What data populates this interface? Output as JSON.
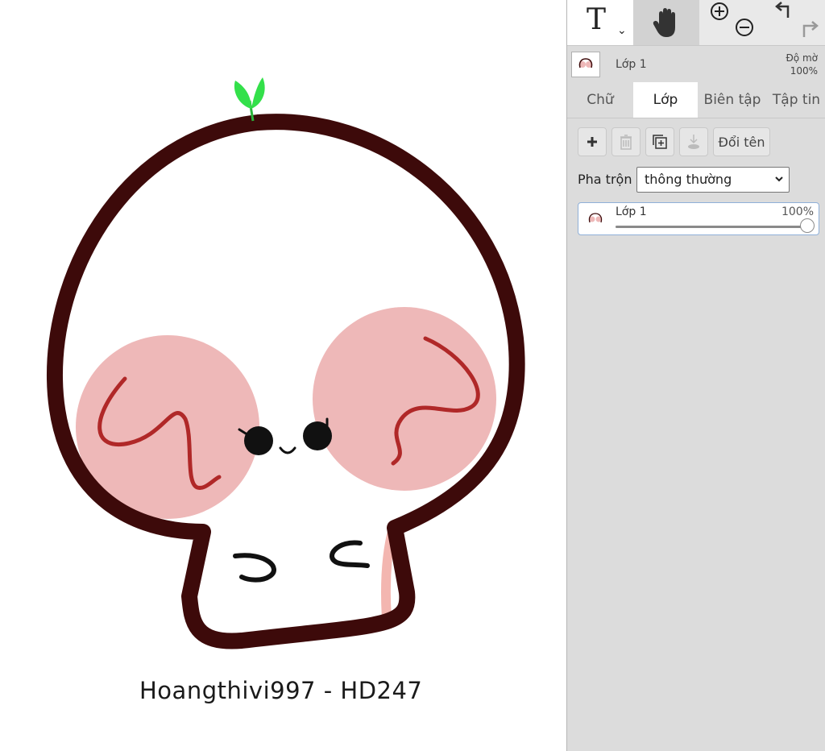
{
  "toolbar": {
    "text_tool_glyph": "T",
    "text_tool_caret": "⌄",
    "tools": [
      "text-tool",
      "hand-tool",
      "zoom-in-icon",
      "zoom-out-icon",
      "undo-icon",
      "redo-icon"
    ]
  },
  "layer_info": {
    "name": "Lớp 1",
    "opacity_label": "Độ mờ",
    "opacity_value": "100%"
  },
  "tabs": [
    {
      "label": "Chữ",
      "active": false
    },
    {
      "label": "Lớp",
      "active": true
    },
    {
      "label": "Biên tập",
      "active": false
    },
    {
      "label": "Tập tin",
      "active": false
    }
  ],
  "layer_buttons": {
    "rename_label": "Đổi tên"
  },
  "blend": {
    "label": "Pha trộn",
    "selected": "thông thường"
  },
  "layers": [
    {
      "name": "Lớp 1",
      "opacity_text": "100%",
      "opacity": 1.0
    }
  ],
  "canvas": {
    "watermark": "Hoangthivi997 - HD247"
  },
  "colors": {
    "panel_bg": "#dcdcdc",
    "outline": "#3d0a0a",
    "blush": "#eeb8b8",
    "sprout": "#33e04a"
  }
}
